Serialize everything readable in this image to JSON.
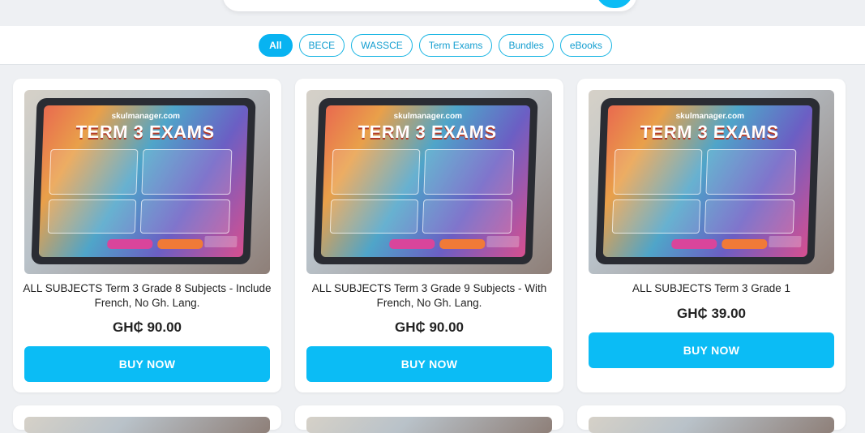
{
  "filters": [
    {
      "label": "All",
      "active": true
    },
    {
      "label": "BECE",
      "active": false
    },
    {
      "label": "WASSCE",
      "active": false
    },
    {
      "label": "Term Exams",
      "active": false
    },
    {
      "label": "Bundles",
      "active": false
    },
    {
      "label": "eBooks",
      "active": false
    }
  ],
  "products": [
    {
      "title": "ALL SUBJECTS Term 3 Grade 8 Subjects - Include French, No Gh. Lang.",
      "price": "GH₵ 90.00",
      "buy_label": "BUY NOW",
      "thumb": {
        "site": "skulmanager.com",
        "headline": "TERM 3 EXAMS"
      }
    },
    {
      "title": "ALL SUBJECTS Term 3 Grade 9 Subjects - With French, No Gh. Lang.",
      "price": "GH₵ 90.00",
      "buy_label": "BUY NOW",
      "thumb": {
        "site": "skulmanager.com",
        "headline": "TERM 3 EXAMS"
      }
    },
    {
      "title": "ALL SUBJECTS Term 3 Grade 1",
      "price": "GH₵ 39.00",
      "buy_label": "BUY NOW",
      "thumb": {
        "site": "skulmanager.com",
        "headline": "TERM 3 EXAMS"
      }
    }
  ],
  "colors": {
    "accent": "#0bbcf5",
    "page_bg": "#eef0f3"
  }
}
